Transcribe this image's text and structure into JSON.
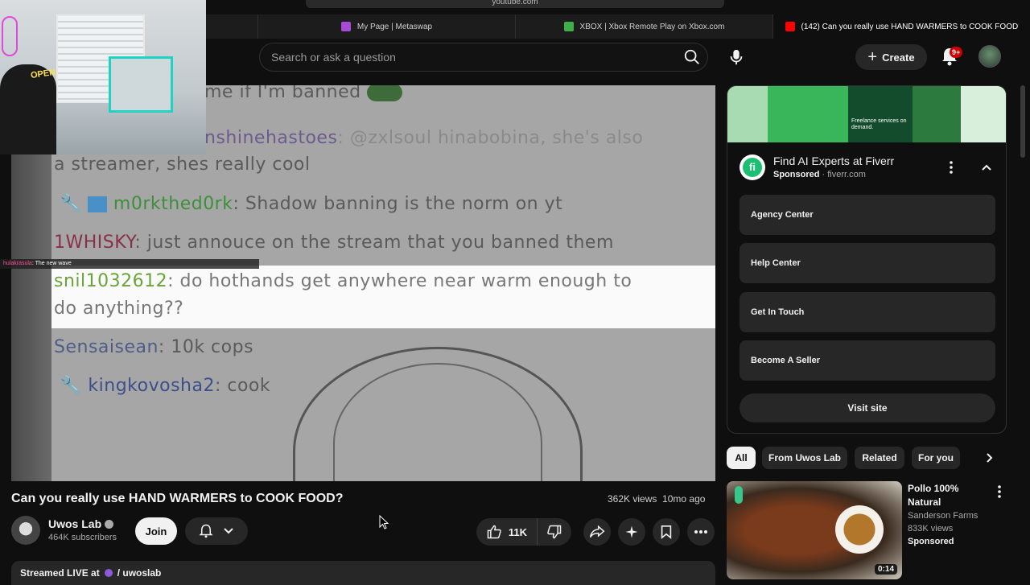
{
  "browser": {
    "url": "youtube.com",
    "tabs": [
      {
        "label": "My Page | Metaswap",
        "icon": "metaswap-icon",
        "color": "#a64bd6"
      },
      {
        "label": "XBOX | Xbox Remote Play on Xbox.com",
        "icon": "xbox-icon",
        "color": "#3fae49"
      },
      {
        "label": "(142) Can you really use HAND WARMERS to COOK FOOD?",
        "icon": "youtube-icon",
        "color": "#ff0000"
      }
    ]
  },
  "header": {
    "search_placeholder": "Search or ask a question",
    "create_label": "Create",
    "notifications_badge": "9+"
  },
  "webcam": {
    "sign_text": "OPEN"
  },
  "video": {
    "chat_lines": [
      {
        "user": "",
        "msg": "me if I'm banned",
        "ucolor": "#5a5a5a"
      },
      {
        "user": "nshinehastoes",
        "msg": ": @zxlsoul hinabobina, she's also",
        "ucolor": "#6d5b8e"
      },
      {
        "user": "",
        "msg": "a streamer, shes really cool",
        "ucolor": "#5a5a5a"
      },
      {
        "user": "m0rkthed0rk",
        "msg": ": Shadow banning is the norm on yt",
        "ucolor": "#3f8f3a"
      },
      {
        "user": "1WHISKY",
        "msg": ": just annouce on the stream that you banned them",
        "ucolor": "#8a2f4a"
      },
      {
        "user": "snil1032612",
        "msg": ": do hothands get anywhere near warm enough to",
        "ucolor": "#6aa33a"
      },
      {
        "user": "",
        "msg": "do anything??",
        "ucolor": "#5a5a5a"
      },
      {
        "user": "Sensaisean",
        "msg": ": 10k cops",
        "ucolor": "#4f5d86"
      },
      {
        "user": "kingkovosha2",
        "msg": ": cook",
        "ucolor": "#3d4f8a"
      }
    ],
    "overlay_user": "hulakrasula",
    "overlay_msg": ": The new wave",
    "title": "Can you really use HAND WARMERS to COOK FOOD?",
    "views": "362K views",
    "age": "10mo ago"
  },
  "channel": {
    "name": "Uwos Lab",
    "subscribers": "464K subscribers",
    "join_label": "Join"
  },
  "actions": {
    "like_count": "11K"
  },
  "description": {
    "prefix": "Streamed LIVE at",
    "link": "/ uwoslab"
  },
  "ad": {
    "banner_text": "Freelance services on demand.",
    "title": "Find AI Experts at Fiverr",
    "sponsored": "Sponsored",
    "domain": "fiverr.com",
    "logo_letter": "fi",
    "links": [
      "Agency Center",
      "Help Center",
      "Get In Touch",
      "Become A Seller"
    ],
    "visit_label": "Visit site"
  },
  "chips": [
    "All",
    "From Uwos Lab",
    "Related",
    "For you"
  ],
  "recommended": {
    "title": "Pollo 100% Natural",
    "channel": "Sanderson Farms",
    "views": "833K views",
    "sponsored": "Sponsored",
    "duration": "0:14"
  }
}
